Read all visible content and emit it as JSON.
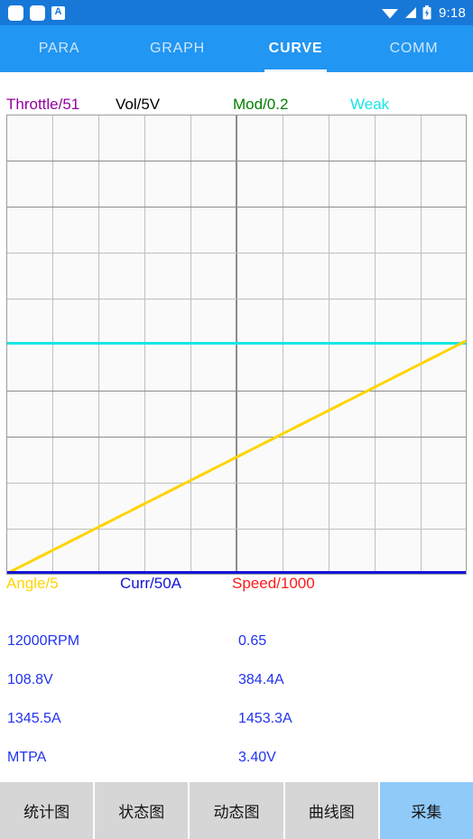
{
  "statusbar": {
    "icons": [
      "app-square-icon",
      "app-square-icon",
      "letter-a-icon",
      "wifi-icon",
      "signal-icon",
      "battery-charging-icon"
    ],
    "letter_a": "A",
    "time": "9:18"
  },
  "tabs": [
    {
      "label": "PARA",
      "active": false
    },
    {
      "label": "GRAPH",
      "active": false
    },
    {
      "label": "CURVE",
      "active": true
    },
    {
      "label": "COMM",
      "active": false
    }
  ],
  "chart_data": {
    "type": "line",
    "title": "",
    "xlabel": "",
    "ylabel": "",
    "grid": true,
    "grid_cols": 10,
    "grid_rows": 10,
    "xlim": [
      0,
      10
    ],
    "ylim": [
      0,
      10
    ],
    "legend_position": "outside-top-and-bottom",
    "top_legend": [
      {
        "label": "Throttle/51",
        "color": "#9400A0"
      },
      {
        "label": "Vol/5V",
        "color": "#000000"
      },
      {
        "label": "Mod/0.2",
        "color": "#008000"
      },
      {
        "label": "Weak",
        "color": "#18E5E5"
      }
    ],
    "bottom_legend": [
      {
        "label": "Angle/5",
        "color": "#FFD400"
      },
      {
        "label": "Curr/50A",
        "color": "#1414D6"
      },
      {
        "label": "Speed/1000",
        "color": "#FF1A1A"
      }
    ],
    "series": [
      {
        "name": "Weak",
        "color": "#18E5E5",
        "style": "horizontal",
        "values": [
          5.05,
          5.05
        ]
      },
      {
        "name": "Curr/50A",
        "color": "#1414D6",
        "style": "horizontal",
        "values": [
          0.02,
          0.02
        ]
      },
      {
        "name": "Angle/5",
        "color": "#FFD400",
        "style": "ramp",
        "x": [
          0,
          10
        ],
        "values": [
          0.05,
          5.25
        ]
      },
      {
        "name": "Throttle/51",
        "color": "#9400A0",
        "style": "flat-zero",
        "values": [
          0,
          0
        ]
      },
      {
        "name": "Vol/5V",
        "color": "#000000",
        "style": "flat-zero",
        "values": [
          0,
          0
        ]
      },
      {
        "name": "Mod/0.2",
        "color": "#008000",
        "style": "flat-zero",
        "values": [
          0,
          0
        ]
      },
      {
        "name": "Speed/1000",
        "color": "#FF1A1A",
        "style": "flat-zero",
        "values": [
          0,
          0
        ]
      }
    ]
  },
  "readouts": [
    {
      "left": "12000RPM",
      "right": "0.65"
    },
    {
      "left": "108.8V",
      "right": "384.4A"
    },
    {
      "left": "1345.5A",
      "right": "1453.3A"
    },
    {
      "left": "MTPA",
      "right": "3.40V"
    }
  ],
  "buttons": [
    {
      "label": "统计图",
      "accent": false
    },
    {
      "label": "状态图",
      "accent": false
    },
    {
      "label": "动态图",
      "accent": false
    },
    {
      "label": "曲线图",
      "accent": false
    },
    {
      "label": "采集",
      "accent": true
    }
  ],
  "colors": {
    "status_bar": "#1778D8",
    "tab_bar": "#2196F3",
    "accent_button": "#90CAF9",
    "button": "#D6D6D6",
    "readout_text": "#2233EE",
    "plot_bg": "#FAFAFA"
  }
}
